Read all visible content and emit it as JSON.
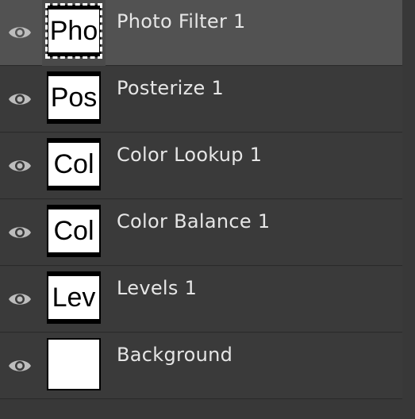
{
  "layers": [
    {
      "name": "Photo Filter 1",
      "thumb_text": "Pho",
      "visibility_icon": "eye-icon",
      "selected": true
    },
    {
      "name": "Posterize 1",
      "thumb_text": "Pos",
      "visibility_icon": "eye-icon",
      "selected": false
    },
    {
      "name": "Color Lookup 1",
      "thumb_text": "Col",
      "visibility_icon": "eye-icon",
      "selected": false
    },
    {
      "name": "Color Balance 1",
      "thumb_text": "Col",
      "visibility_icon": "eye-icon",
      "selected": false
    },
    {
      "name": "Levels 1",
      "thumb_text": "Lev",
      "visibility_icon": "eye-icon",
      "selected": false
    },
    {
      "name": "Background",
      "thumb_text": "",
      "visibility_icon": "eye-icon",
      "selected": false
    }
  ],
  "colors": {
    "panel_bg": "#383838",
    "selected_row_bg": "#525252",
    "text": "#e6e6e6"
  }
}
